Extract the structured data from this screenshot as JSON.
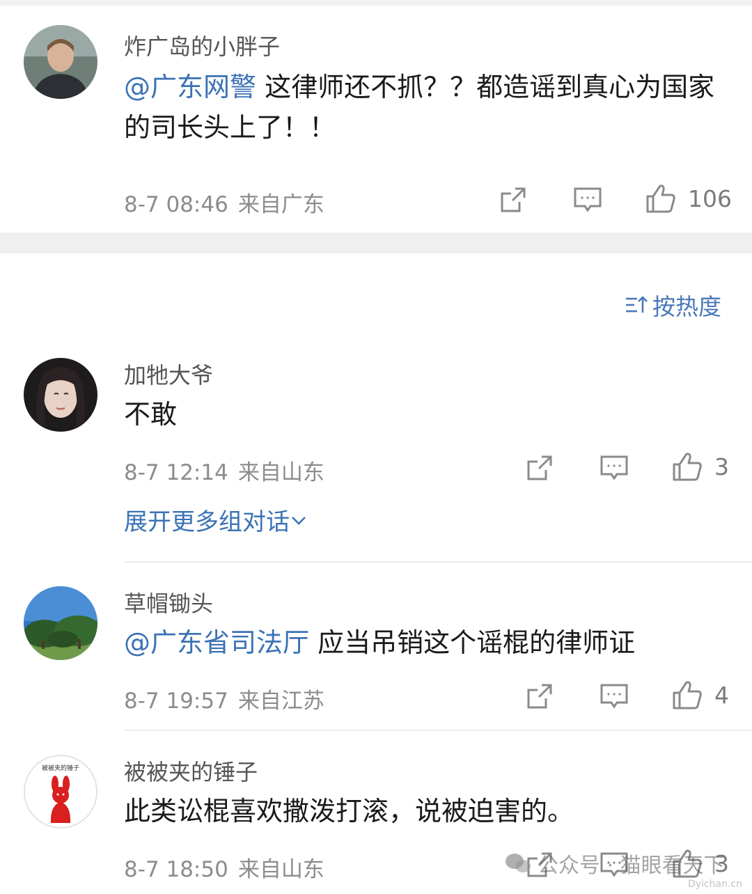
{
  "sort": {
    "label": "按热度"
  },
  "expand": {
    "label": "展开更多组对话"
  },
  "comments": [
    {
      "username": "炸广岛的小胖子",
      "mention": "@广东网警",
      "text": " 这律师还不抓？？都造谣到真心为国家的司长头上了！！",
      "date": "8-7 08:46",
      "location": "来自广东",
      "likes": "106"
    },
    {
      "username": "加牠大爷",
      "mention": "",
      "text": "不敢",
      "date": "8-7 12:14",
      "location": "来自山东",
      "likes": "3"
    },
    {
      "username": "草帽锄头",
      "mention": "@广东省司法厅",
      "text": " 应当吊销这个谣棍的律师证",
      "date": "8-7 19:57",
      "location": "来自江苏",
      "likes": "4"
    },
    {
      "username": "被被夹的锤子",
      "avatar_caption": "被被夹的锤子",
      "mention": "",
      "text": "此类讼棍喜欢撒泼打滚，说被迫害的。",
      "date": "8-7 18:50",
      "location": "来自山东",
      "likes": "3"
    }
  ],
  "watermark": {
    "text": "公众号 · 猫眼看天下",
    "sub": "Dyichan.cn"
  }
}
